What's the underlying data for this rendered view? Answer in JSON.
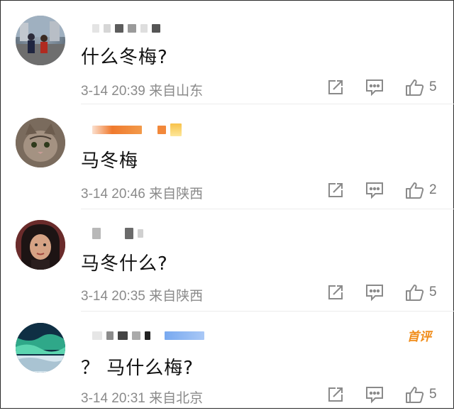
{
  "comments": [
    {
      "text": "什么冬梅?",
      "meta": "3-14 20:39 来自山东",
      "likes": "5",
      "badge": ""
    },
    {
      "text": "马冬梅",
      "meta": "3-14 20:46 来自陕西",
      "likes": "2",
      "badge": ""
    },
    {
      "text": "马冬什么?",
      "meta": "3-14 20:35 来自陕西",
      "likes": "5",
      "badge": ""
    },
    {
      "text": "？ 马什么梅?",
      "meta": "3-14 20:31 来自北京",
      "likes": "5",
      "badge": "首评"
    }
  ],
  "icons": {
    "forward": "share-edit-icon",
    "reply": "comment-bubble-icon",
    "like": "thumbs-up-icon"
  },
  "colors": {
    "meta_text": "#8a8a8a",
    "badge": "#f08c1a"
  }
}
